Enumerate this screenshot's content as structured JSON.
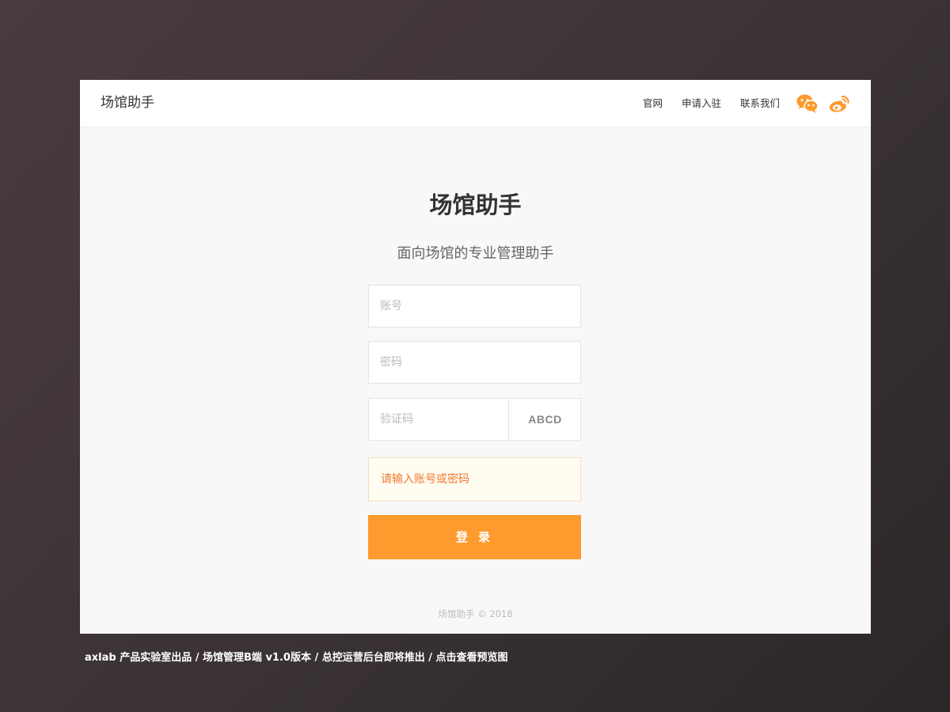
{
  "header": {
    "brand": "场馆助手",
    "nav": [
      "官网",
      "申请入驻",
      "联系我们"
    ],
    "icons": [
      "wechat-icon",
      "weibo-icon"
    ],
    "accent_color": "#ff9a2e"
  },
  "main": {
    "title": "场馆助手",
    "subtitle": "面向场馆的专业管理助手",
    "account_placeholder": "账号",
    "password_placeholder": "密码",
    "captcha_placeholder": "验证码",
    "captcha_code": "ABCD",
    "error_message": "请输入账号或密码",
    "login_label": "登 录",
    "copyright": "场馆助手 © 2018"
  },
  "caption": "axlab 产品实验室出品 / 场馆管理B端 v1.0版本 / 总控运营后台即将推出  / 点击查看预览图"
}
